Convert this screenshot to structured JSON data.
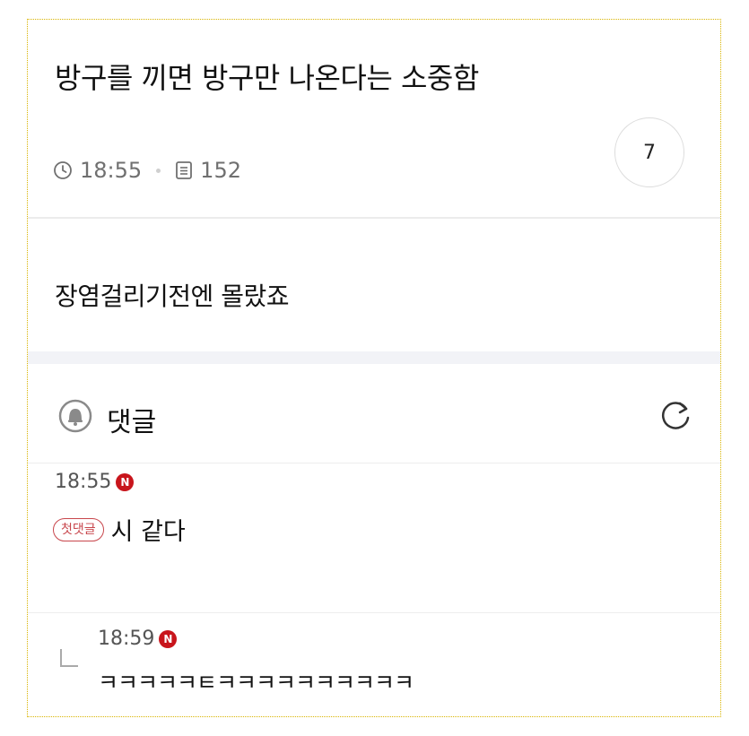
{
  "post": {
    "title": "방구를 끼면 방구만 나온다는 소중함",
    "time": "18:55",
    "views": "152",
    "comment_count": "7",
    "body": "장염걸리기전엔 몰랐죠"
  },
  "comments_section": {
    "title": "댓글",
    "icons": {
      "bell": "bell-icon",
      "refresh": "refresh-icon",
      "clock": "clock-icon",
      "views": "document-icon"
    }
  },
  "comments": [
    {
      "time": "18:55",
      "new_badge": "N",
      "first_badge": "첫댓글",
      "text": "시 같다"
    },
    {
      "time": "18:59",
      "new_badge": "N",
      "text": "ㅋㅋㅋㅋㅋㅌㅋㅋㅋㅋㅋㅋㅋㅋㅋㅋ"
    }
  ],
  "colors": {
    "accent_red": "#c8151c",
    "first_badge": "#c8464c",
    "meta_gray": "#707070"
  }
}
